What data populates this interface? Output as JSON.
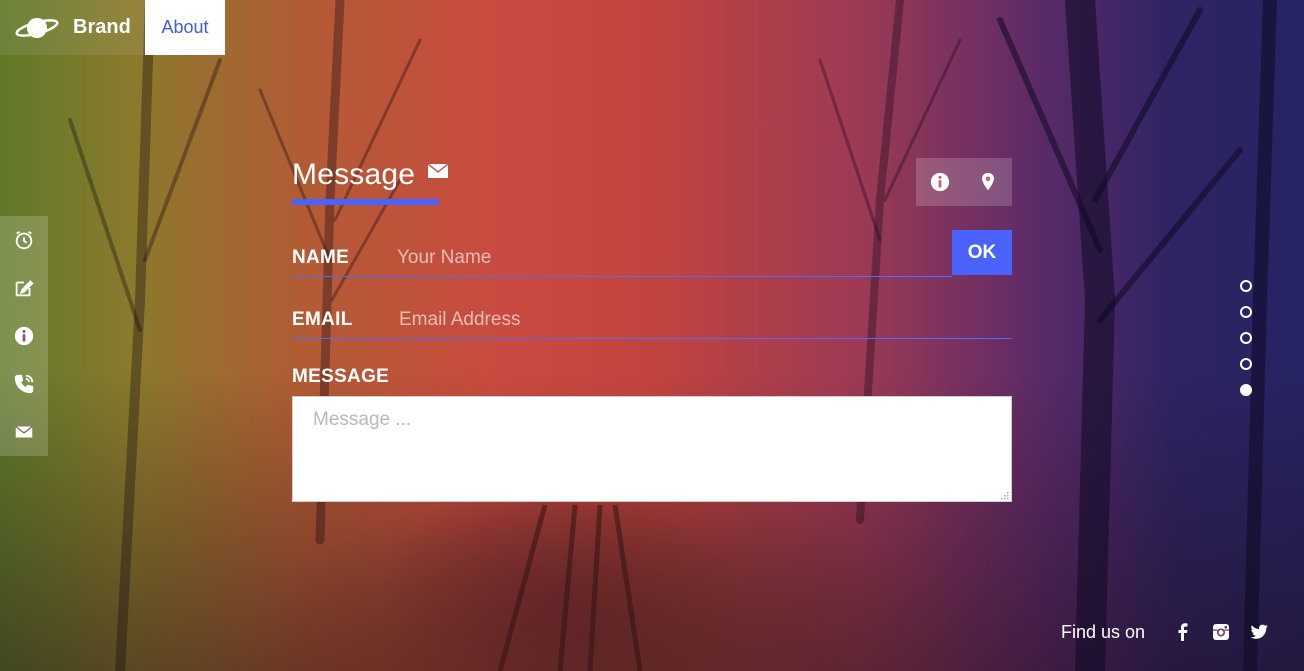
{
  "nav": {
    "brand_label": "Brand",
    "about_label": "About",
    "brand_icon": "planet-icon"
  },
  "sidebar": {
    "items": [
      {
        "icon": "clock-icon"
      },
      {
        "icon": "edit-icon"
      },
      {
        "icon": "info-icon"
      },
      {
        "icon": "phone-icon"
      },
      {
        "icon": "mail-icon"
      }
    ]
  },
  "form": {
    "title": "Message",
    "title_icon": "mail-icon",
    "info_buttons": [
      {
        "icon": "info-icon"
      },
      {
        "icon": "location-pin-icon"
      }
    ],
    "name_label": "NAME",
    "name_placeholder": "Your Name",
    "ok_label": "OK",
    "email_label": "EMAIL",
    "email_placeholder": "Email Address",
    "message_label": "MESSAGE",
    "message_placeholder": "Message ..."
  },
  "pagination": {
    "count": 5,
    "active_index": 4
  },
  "footer": {
    "find_label": "Find us on",
    "social": [
      "facebook-icon",
      "instagram-icon",
      "twitter-icon"
    ]
  },
  "colors": {
    "accent": "#4a63ff",
    "about_text": "#3e5be6",
    "white": "#ffffff"
  }
}
